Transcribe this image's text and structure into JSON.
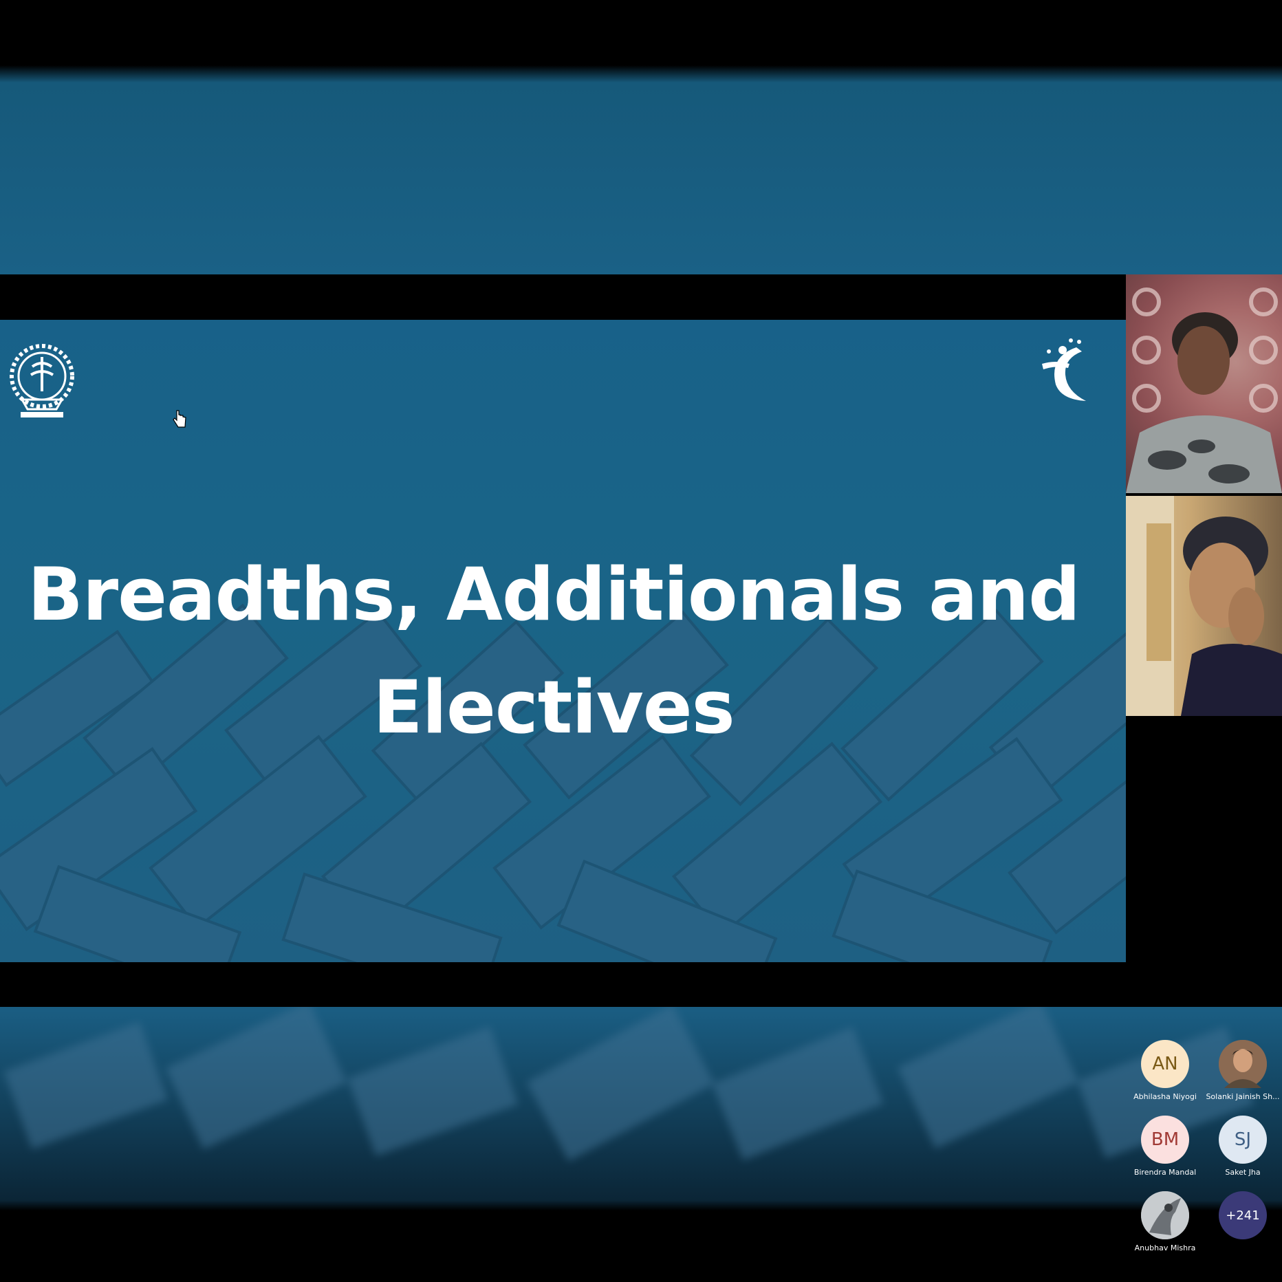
{
  "slide": {
    "title_line1": "Breadths, Additionals and",
    "title_line2": "Electives"
  },
  "colors": {
    "slide_bg": "#1a6587",
    "accent_more": "#3b3a78"
  },
  "participants": [
    {
      "initials": "AN",
      "name": "Abhilasha Niyogi",
      "avatar_bg": "#fbe6c6",
      "avatar_fg": "#7a5a16"
    },
    {
      "initials": "",
      "name": "Solanki Jainish Sh...",
      "avatar_bg": "#7b5a44",
      "avatar_fg": "#ffffff"
    },
    {
      "initials": "BM",
      "name": "Birendra Mandal",
      "avatar_bg": "#fbe0df",
      "avatar_fg": "#a13a35"
    },
    {
      "initials": "SJ",
      "name": "Saket Jha",
      "avatar_bg": "#dfe8f2",
      "avatar_fg": "#3f5f84"
    },
    {
      "initials": "",
      "name": "Anubhav Mishra",
      "avatar_bg": "#8a8f94",
      "avatar_fg": "#ffffff"
    },
    {
      "initials": "+241",
      "name": "",
      "avatar_bg": "#3b3a78",
      "avatar_fg": "#ffffff"
    }
  ]
}
